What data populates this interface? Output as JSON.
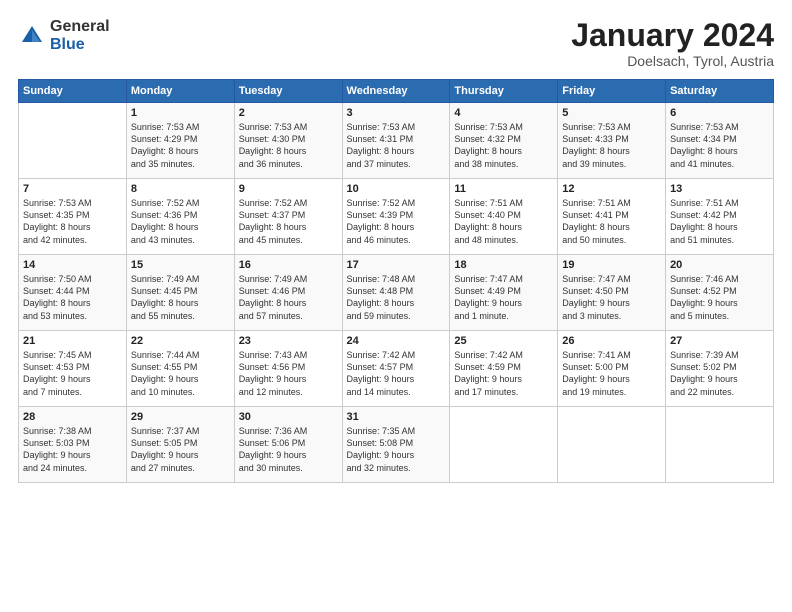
{
  "header": {
    "logo_general": "General",
    "logo_blue": "Blue",
    "title": "January 2024",
    "subtitle": "Doelsach, Tyrol, Austria"
  },
  "weekdays": [
    "Sunday",
    "Monday",
    "Tuesday",
    "Wednesday",
    "Thursday",
    "Friday",
    "Saturday"
  ],
  "weeks": [
    [
      {
        "day": "",
        "text": ""
      },
      {
        "day": "1",
        "text": "Sunrise: 7:53 AM\nSunset: 4:29 PM\nDaylight: 8 hours\nand 35 minutes."
      },
      {
        "day": "2",
        "text": "Sunrise: 7:53 AM\nSunset: 4:30 PM\nDaylight: 8 hours\nand 36 minutes."
      },
      {
        "day": "3",
        "text": "Sunrise: 7:53 AM\nSunset: 4:31 PM\nDaylight: 8 hours\nand 37 minutes."
      },
      {
        "day": "4",
        "text": "Sunrise: 7:53 AM\nSunset: 4:32 PM\nDaylight: 8 hours\nand 38 minutes."
      },
      {
        "day": "5",
        "text": "Sunrise: 7:53 AM\nSunset: 4:33 PM\nDaylight: 8 hours\nand 39 minutes."
      },
      {
        "day": "6",
        "text": "Sunrise: 7:53 AM\nSunset: 4:34 PM\nDaylight: 8 hours\nand 41 minutes."
      }
    ],
    [
      {
        "day": "7",
        "text": "Sunrise: 7:53 AM\nSunset: 4:35 PM\nDaylight: 8 hours\nand 42 minutes."
      },
      {
        "day": "8",
        "text": "Sunrise: 7:52 AM\nSunset: 4:36 PM\nDaylight: 8 hours\nand 43 minutes."
      },
      {
        "day": "9",
        "text": "Sunrise: 7:52 AM\nSunset: 4:37 PM\nDaylight: 8 hours\nand 45 minutes."
      },
      {
        "day": "10",
        "text": "Sunrise: 7:52 AM\nSunset: 4:39 PM\nDaylight: 8 hours\nand 46 minutes."
      },
      {
        "day": "11",
        "text": "Sunrise: 7:51 AM\nSunset: 4:40 PM\nDaylight: 8 hours\nand 48 minutes."
      },
      {
        "day": "12",
        "text": "Sunrise: 7:51 AM\nSunset: 4:41 PM\nDaylight: 8 hours\nand 50 minutes."
      },
      {
        "day": "13",
        "text": "Sunrise: 7:51 AM\nSunset: 4:42 PM\nDaylight: 8 hours\nand 51 minutes."
      }
    ],
    [
      {
        "day": "14",
        "text": "Sunrise: 7:50 AM\nSunset: 4:44 PM\nDaylight: 8 hours\nand 53 minutes."
      },
      {
        "day": "15",
        "text": "Sunrise: 7:49 AM\nSunset: 4:45 PM\nDaylight: 8 hours\nand 55 minutes."
      },
      {
        "day": "16",
        "text": "Sunrise: 7:49 AM\nSunset: 4:46 PM\nDaylight: 8 hours\nand 57 minutes."
      },
      {
        "day": "17",
        "text": "Sunrise: 7:48 AM\nSunset: 4:48 PM\nDaylight: 8 hours\nand 59 minutes."
      },
      {
        "day": "18",
        "text": "Sunrise: 7:47 AM\nSunset: 4:49 PM\nDaylight: 9 hours\nand 1 minute."
      },
      {
        "day": "19",
        "text": "Sunrise: 7:47 AM\nSunset: 4:50 PM\nDaylight: 9 hours\nand 3 minutes."
      },
      {
        "day": "20",
        "text": "Sunrise: 7:46 AM\nSunset: 4:52 PM\nDaylight: 9 hours\nand 5 minutes."
      }
    ],
    [
      {
        "day": "21",
        "text": "Sunrise: 7:45 AM\nSunset: 4:53 PM\nDaylight: 9 hours\nand 7 minutes."
      },
      {
        "day": "22",
        "text": "Sunrise: 7:44 AM\nSunset: 4:55 PM\nDaylight: 9 hours\nand 10 minutes."
      },
      {
        "day": "23",
        "text": "Sunrise: 7:43 AM\nSunset: 4:56 PM\nDaylight: 9 hours\nand 12 minutes."
      },
      {
        "day": "24",
        "text": "Sunrise: 7:42 AM\nSunset: 4:57 PM\nDaylight: 9 hours\nand 14 minutes."
      },
      {
        "day": "25",
        "text": "Sunrise: 7:42 AM\nSunset: 4:59 PM\nDaylight: 9 hours\nand 17 minutes."
      },
      {
        "day": "26",
        "text": "Sunrise: 7:41 AM\nSunset: 5:00 PM\nDaylight: 9 hours\nand 19 minutes."
      },
      {
        "day": "27",
        "text": "Sunrise: 7:39 AM\nSunset: 5:02 PM\nDaylight: 9 hours\nand 22 minutes."
      }
    ],
    [
      {
        "day": "28",
        "text": "Sunrise: 7:38 AM\nSunset: 5:03 PM\nDaylight: 9 hours\nand 24 minutes."
      },
      {
        "day": "29",
        "text": "Sunrise: 7:37 AM\nSunset: 5:05 PM\nDaylight: 9 hours\nand 27 minutes."
      },
      {
        "day": "30",
        "text": "Sunrise: 7:36 AM\nSunset: 5:06 PM\nDaylight: 9 hours\nand 30 minutes."
      },
      {
        "day": "31",
        "text": "Sunrise: 7:35 AM\nSunset: 5:08 PM\nDaylight: 9 hours\nand 32 minutes."
      },
      {
        "day": "",
        "text": ""
      },
      {
        "day": "",
        "text": ""
      },
      {
        "day": "",
        "text": ""
      }
    ]
  ]
}
